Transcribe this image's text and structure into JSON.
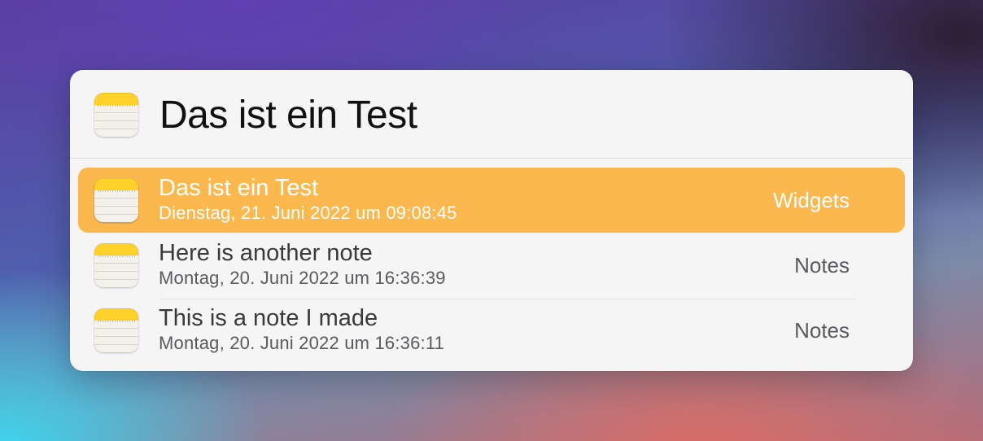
{
  "search": {
    "query": "Das ist ein Test",
    "icon": "notes-app-icon"
  },
  "results": [
    {
      "title": "Das ist ein Test",
      "subtitle": "Dienstag, 21. Juni 2022 um 09:08:45",
      "source": "Widgets",
      "icon": "notes-app-icon",
      "selected": true
    },
    {
      "title": "Here is another note",
      "subtitle": "Montag, 20. Juni 2022 um 16:36:39",
      "source": "Notes",
      "icon": "notes-app-icon",
      "selected": false
    },
    {
      "title": "This is a note I made",
      "subtitle": "Montag, 20. Juni 2022 um 16:36:11",
      "source": "Notes",
      "icon": "notes-app-icon",
      "selected": false
    }
  ],
  "colors": {
    "selection": "#fbb84e",
    "panel": "#f5f5f6",
    "icon_accent": "#ffd12a"
  }
}
